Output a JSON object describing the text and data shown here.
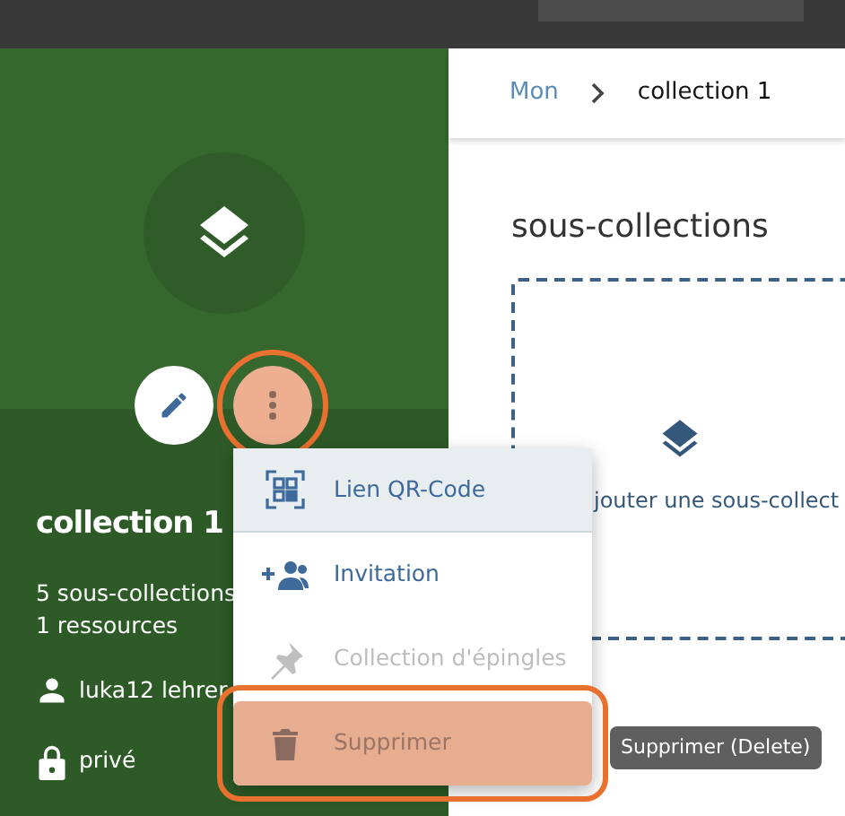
{
  "collection": {
    "title": "collection 1",
    "stats": [
      "5 sous-collections",
      "1 ressources"
    ],
    "owner": "luka12 lehrer",
    "visibility": "privé"
  },
  "actions": {
    "more_highlighted": true
  },
  "breadcrumb": [
    {
      "label": "Mon",
      "current": false
    },
    {
      "label": "collection 1",
      "current": true
    }
  ],
  "section": {
    "title": "sous-collections",
    "add_label": "jouter une sous-collect"
  },
  "menu": [
    {
      "kind": "qr",
      "label": "Lien QR-Code",
      "hovered": true,
      "disabled": false,
      "highlighted": false
    },
    {
      "kind": "invite",
      "label": "Invitation",
      "hovered": false,
      "disabled": false,
      "highlighted": false
    },
    {
      "kind": "pin",
      "label": "Collection d'épingles",
      "hovered": false,
      "disabled": true,
      "highlighted": false
    },
    {
      "kind": "delete",
      "label": "Supprimer",
      "hovered": false,
      "disabled": true,
      "highlighted": true
    }
  ],
  "tooltip": "Supprimer (Delete)"
}
